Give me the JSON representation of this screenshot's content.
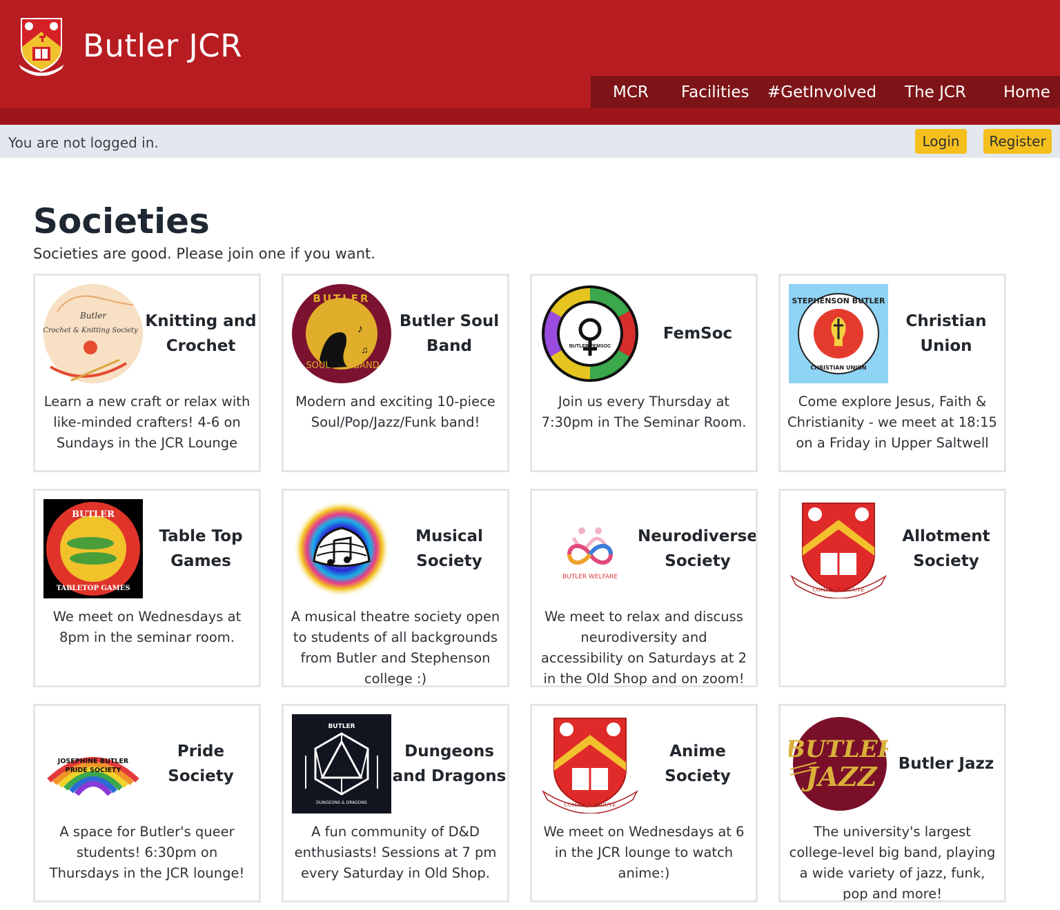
{
  "header": {
    "site_title": "Butler JCR",
    "nav": [
      "MCR",
      "Facilities",
      "#GetInvolved",
      "The JCR",
      "Home"
    ]
  },
  "loginbar": {
    "status": "You are not logged in.",
    "login_label": "Login",
    "register_label": "Register"
  },
  "main": {
    "title": "Societies",
    "subtitle": "Societies are good. Please join one if you want."
  },
  "societies": [
    {
      "name": "Knitting and Crochet",
      "description": "Learn a new craft or relax with like-minded crafters! 4-6 on Sundays in the JCR Lounge",
      "logo_text": [
        "Butler",
        "Crochet & Knitting Society"
      ]
    },
    {
      "name": "Butler Soul Band",
      "description": "Modern and exciting 10-piece Soul/Pop/Jazz/Funk band!",
      "logo_text": [
        "BUTLER",
        "SOUL",
        "BAND"
      ]
    },
    {
      "name": "FemSoc",
      "description": "Join us every Thursday at 7:30pm in The Seminar Room.",
      "logo_text": [
        "BUTLER FEMSOC"
      ]
    },
    {
      "name": "Christian Union",
      "description": "Come explore Jesus, Faith & Christianity - we meet at 18:15 on a Friday in Upper Saltwell",
      "logo_text": [
        "STEPHENSON BUTLER",
        "CHRISTIAN UNION"
      ]
    },
    {
      "name": "Table Top Games",
      "description": "We meet on Wednesdays at 8pm in the seminar room.",
      "logo_text": [
        "BUTLER",
        "TABLETOP GAMES"
      ]
    },
    {
      "name": "Musical Society",
      "description": "A musical theatre society open to students of all backgrounds from Butler and Stephenson college :)",
      "logo_text": []
    },
    {
      "name": "Neurodiverse Society",
      "description": "We meet to relax and discuss neurodiversity and accessibility on Saturdays at 2 in the Old Shop and on zoom!",
      "logo_text": [
        "BUTLER WELFARE"
      ]
    },
    {
      "name": "Allotment Society",
      "description": "",
      "logo_text": [
        "COMME JE TROUVE"
      ]
    },
    {
      "name": "Pride Society",
      "description": "A space for Butler's queer students! 6:30pm on Thursdays in the JCR lounge!",
      "logo_text": [
        "JOSEPHINE BUTLER",
        "PRIDE SOCIETY"
      ]
    },
    {
      "name": "Dungeons and Dragons",
      "description": "A fun community of D&D enthusiasts! Sessions at 7 pm every Saturday in Old Shop.",
      "logo_text": [
        "BUTLER",
        "DUNGEONS & DRAGONS"
      ]
    },
    {
      "name": "Anime Society",
      "description": "We meet on Wednesdays at 6 in the JCR lounge to watch anime:)",
      "logo_text": [
        "COMME JE TROUVE"
      ]
    },
    {
      "name": "Butler Jazz",
      "description": "The university's largest college-level big band, playing a wide variety of jazz, funk, pop and more!",
      "logo_text": [
        "BUTLER",
        "JAZZ"
      ]
    }
  ],
  "colors": {
    "header_red": "#b71c21",
    "nav_dark_red": "#7d1418",
    "button_yellow": "#f5bf1d",
    "login_bar": "#e3e8ee"
  }
}
